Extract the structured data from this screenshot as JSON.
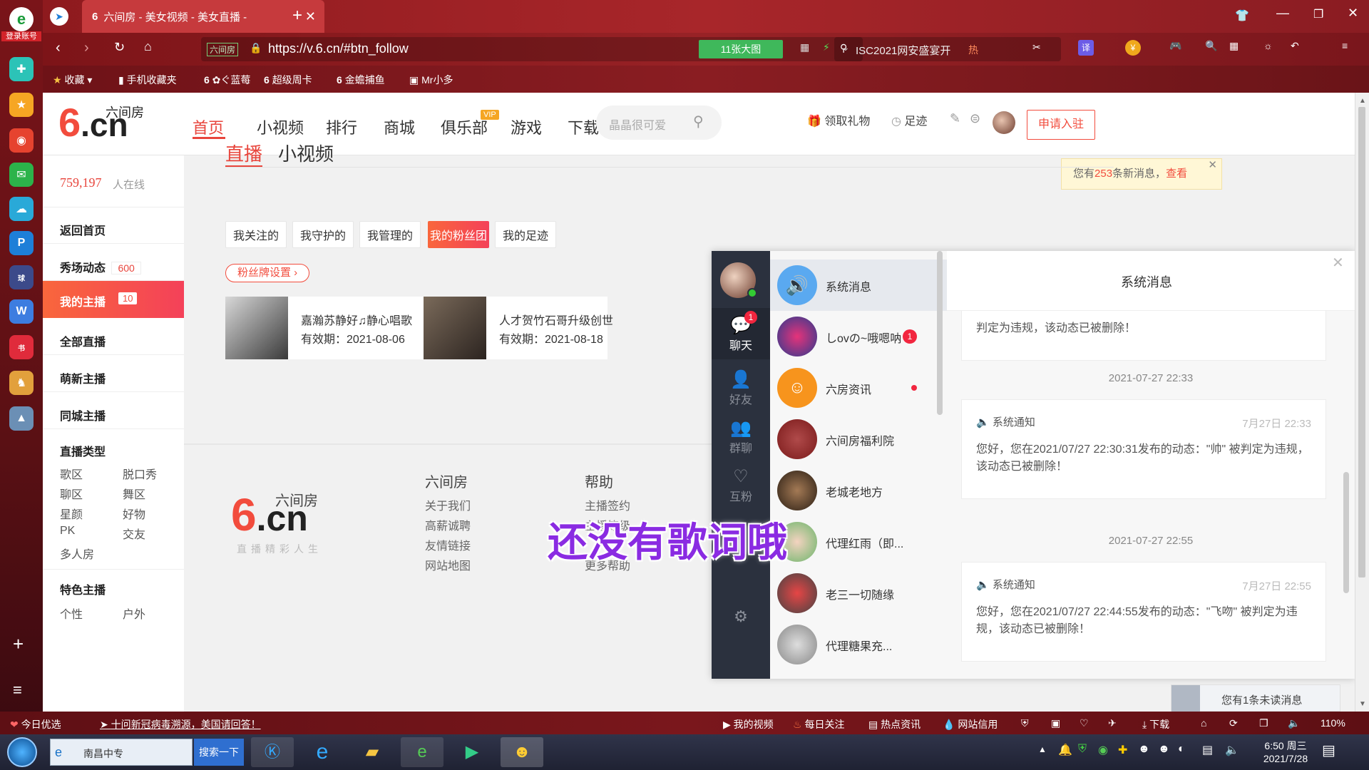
{
  "browser": {
    "tab_title": "六间房 - 美女视频 - 美女直播 -",
    "url": "https://v.6.cn/#btn_follow",
    "site_badge": "六间房",
    "big_images": "11张大图",
    "search_text": "ISC2021网安盛宴开",
    "hot": "热",
    "login_account": "登录账号"
  },
  "bookmarks": [
    "收藏",
    "手机收藏夹",
    "ぐ蓝莓",
    "超级周卡",
    "金蟾捕鱼",
    "Mr小多"
  ],
  "site": {
    "logo_cn": "六间房",
    "logo_en": ".cn",
    "nav": [
      "首页",
      "小视频",
      "排行",
      "商城",
      "俱乐部",
      "游戏",
      "下载"
    ],
    "vip": "VIP",
    "search_placeholder": "晶晶很可爱",
    "gift": "领取礼物",
    "footprint": "足迹",
    "apply": "申请入驻"
  },
  "notice": {
    "prefix": "您有",
    "count": "253",
    "suffix": "条新消息，",
    "link": "查看"
  },
  "sidebar": {
    "online_count": "759,197",
    "online_label": "人在线",
    "items": [
      {
        "label": "返回首页"
      },
      {
        "label": "秀场动态",
        "badge": "600"
      },
      {
        "label": "我的主播",
        "badge": "10"
      },
      {
        "label": "全部直播"
      },
      {
        "label": "萌新主播"
      },
      {
        "label": "同城主播"
      },
      {
        "label": "直播类型"
      }
    ],
    "types": [
      "歌区",
      "脱口秀",
      "聊区",
      "舞区",
      "星颜",
      "好物",
      "PK",
      "交友",
      "多人房"
    ],
    "special": "特色主播",
    "special_sub": [
      "个性",
      "户外"
    ]
  },
  "main": {
    "tabs": [
      "直播",
      "小视频"
    ],
    "filters": [
      "我关注的",
      "我守护的",
      "我管理的",
      "我的粉丝团",
      "我的足迹"
    ],
    "badge_setting": "粉丝牌设置",
    "cards": [
      {
        "title": "嘉瀚苏静好♫静心唱歌",
        "valid": "有效期：2021-08-06"
      },
      {
        "title": "人才贺竹石哥升级创世",
        "valid": "有效期：2021-08-18"
      }
    ]
  },
  "footer": {
    "logo_cn": "六间房",
    "logo_en": ".cn",
    "slogan": "直播精彩人生",
    "col1_title": "六间房",
    "col1": [
      "关于我们",
      "高薪诚聘",
      "友情链接",
      "网站地图"
    ],
    "col2_title": "帮助",
    "col2": [
      "主播签约",
      "主播等级",
      "",
      "更多帮助"
    ]
  },
  "chat": {
    "side": [
      {
        "label": "聊天",
        "badge": "1"
      },
      {
        "label": "好友"
      },
      {
        "label": "群聊"
      },
      {
        "label": "互粉"
      }
    ],
    "list": [
      {
        "name": "系统消息"
      },
      {
        "name": "しovの~哦嗯呐",
        "badge": "1"
      },
      {
        "name": "六房资讯"
      },
      {
        "name": "六间房福利院"
      },
      {
        "name": "老城老地方"
      },
      {
        "name": "代理红雨（即..."
      },
      {
        "name": "老三一切随缘"
      },
      {
        "name": "代理糖果充..."
      }
    ],
    "panel_title": "系统消息",
    "partial_text": "判定为违规，该动态已被删除！",
    "messages": [
      {
        "time": "2021-07-27 22:33",
        "type": "系统通知",
        "date": "7月27日 22:33",
        "body": "您好，您在2021/07/27 22:30:31发布的动态：\"帅\" 被判定为违规，该动态已被删除！"
      },
      {
        "time": "2021-07-27 22:55",
        "type": "系统通知",
        "date": "7月27日 22:55",
        "body": "您好，您在2021/07/27 22:44:55发布的动态：\"飞吻\" 被判定为违规，该动态已被删除！"
      }
    ],
    "unread": "您有1条未读消息"
  },
  "lyric": "还没有歌词哦",
  "statusbar": {
    "today": "今日优选",
    "news": "十问新冠病毒溯源，美国请回答！",
    "items": [
      "我的视频",
      "每日关注",
      "热点资讯",
      "网站信用",
      "下载"
    ],
    "zoom": "110%"
  },
  "taskbar": {
    "ie_text": "南昌中专",
    "search_btn": "搜索一下",
    "time": "6:50 周三",
    "date": "2021/7/28"
  },
  "colors": {
    "accent": "#f24c3d",
    "nav_active": "#e8453c"
  }
}
